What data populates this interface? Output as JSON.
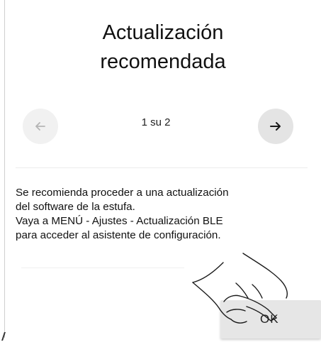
{
  "dialog": {
    "title_line1": "Actualización",
    "title_line2": "recomendada"
  },
  "pager": {
    "current": 1,
    "total": 2,
    "indicator_text": "1 su 2",
    "prev_icon": "arrow-left-icon",
    "next_icon": "arrow-right-icon"
  },
  "message": {
    "line1": "Se recomienda proceder a una actualización",
    "line2": "del software de la estufa.",
    "line3": "Vaya a MENÚ - Ajustes - Actualización BLE",
    "line4": "para acceder al asistente de configuración."
  },
  "actions": {
    "ok_label": "OK"
  },
  "overlay": {
    "pointer_icon": "hand-pointer-icon"
  }
}
